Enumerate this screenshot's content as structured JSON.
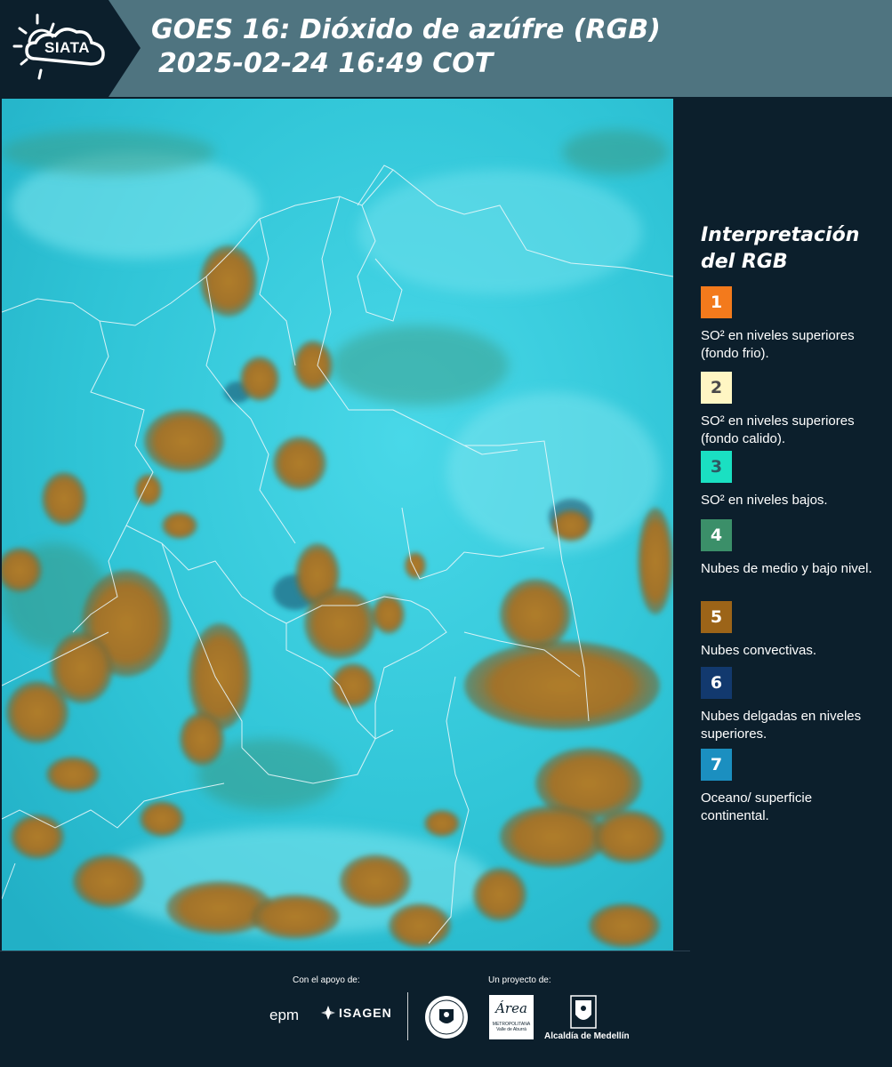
{
  "header": {
    "logo_text": "SIATA",
    "title_line1": "GOES 16: Dióxido de azúfre (RGB)",
    "title_line2": "2025-02-24 16:49 COT"
  },
  "legend": {
    "title_line1": "Interpretación",
    "title_line2": "del RGB",
    "items": [
      {
        "number": "1",
        "label": "SO² en niveles superiores (fondo frio).",
        "color": "#f37a1c",
        "text_color": "#ffffff"
      },
      {
        "number": "2",
        "label": "SO² en niveles superiores (fondo calido).",
        "color": "#fff6c3",
        "text_color": "#4a4a4a"
      },
      {
        "number": "3",
        "label": "SO² en niveles bajos.",
        "color": "#1ae0c2",
        "text_color": "#2d5a63"
      },
      {
        "number": "4",
        "label": "Nubes de medio y bajo nivel.",
        "color": "#3b8f69",
        "text_color": "#ffffff"
      },
      {
        "number": "5",
        "label": "Nubes convectivas.",
        "color": "#9c6418",
        "text_color": "#ffffff"
      },
      {
        "number": "6",
        "label": "Nubes delgadas en niveles superiores.",
        "color": "#12396e",
        "text_color": "#ffffff"
      },
      {
        "number": "7",
        "label": "Oceano/ superficie continental.",
        "color": "#1b8fc0",
        "text_color": "#ffffff"
      }
    ]
  },
  "footer": {
    "support_label": "Con el apoyo de:",
    "project_label": "Un proyecto de:",
    "logos": {
      "epm": "epm",
      "isagen": "ISAGEN",
      "area_metropolitana": "Área",
      "area_metropolitana_sub": "METROPOLITANA",
      "area_metropolitana_sub2": "Valle de Aburrá",
      "alcaldia": "Alcaldía de Medellín"
    }
  },
  "colors": {
    "background": "#0c1f2c",
    "header": "#4f7480",
    "map_cyan": "#2fc4d6",
    "convective_cloud": "#a57a2a"
  }
}
